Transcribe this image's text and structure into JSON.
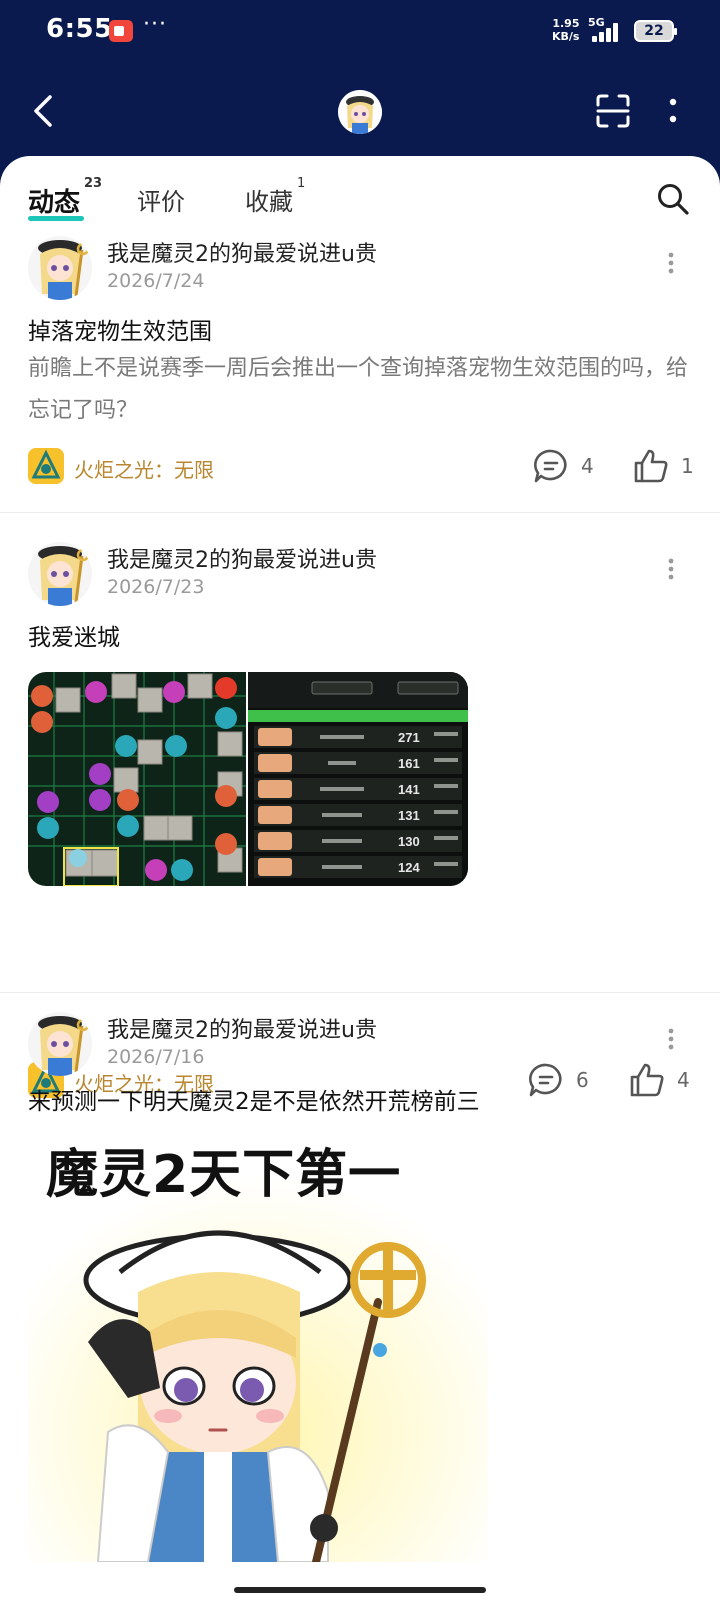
{
  "status_bar": {
    "time": "6:55",
    "more": "···",
    "net_speed_value": "1.95",
    "net_speed_unit": "KB/s",
    "net_type": "5G",
    "battery": "22"
  },
  "tabs": [
    {
      "label": "动态",
      "count": "23"
    },
    {
      "label": "评价",
      "count": ""
    },
    {
      "label": "收藏",
      "count": "1"
    }
  ],
  "posts": [
    {
      "author": "我是魔灵2的狗最爱说进u贵",
      "date": "2026/7/24",
      "title": "掉落宠物生效范围",
      "body": "前瞻上不是说赛季一周后会推出一个查询掉落宠物生效范围的吗，给忘记了吗？",
      "game": "火炬之光：无限",
      "comments": "4",
      "likes": "1"
    },
    {
      "author": "我是魔灵2的狗最爱说进u贵",
      "date": "2026/7/23",
      "title": "我爱迷城",
      "game": "火炬之光：无限",
      "comments": "6",
      "likes": "4",
      "leaderboard_values": [
        "271",
        "161",
        "141",
        "131",
        "130",
        "124"
      ]
    },
    {
      "author": "我是魔灵2的狗最爱说进u贵",
      "date": "2026/7/16",
      "title": "来预测一下明天魔灵2是不是依然开荒榜前三",
      "meme_caption": "魔灵2天下第一"
    }
  ],
  "colors": {
    "header_bg": "#0b1a4e",
    "tab_accent": "#1cc6b8",
    "game_tag_text": "#b8862e",
    "rec_red": "#f0463c"
  }
}
